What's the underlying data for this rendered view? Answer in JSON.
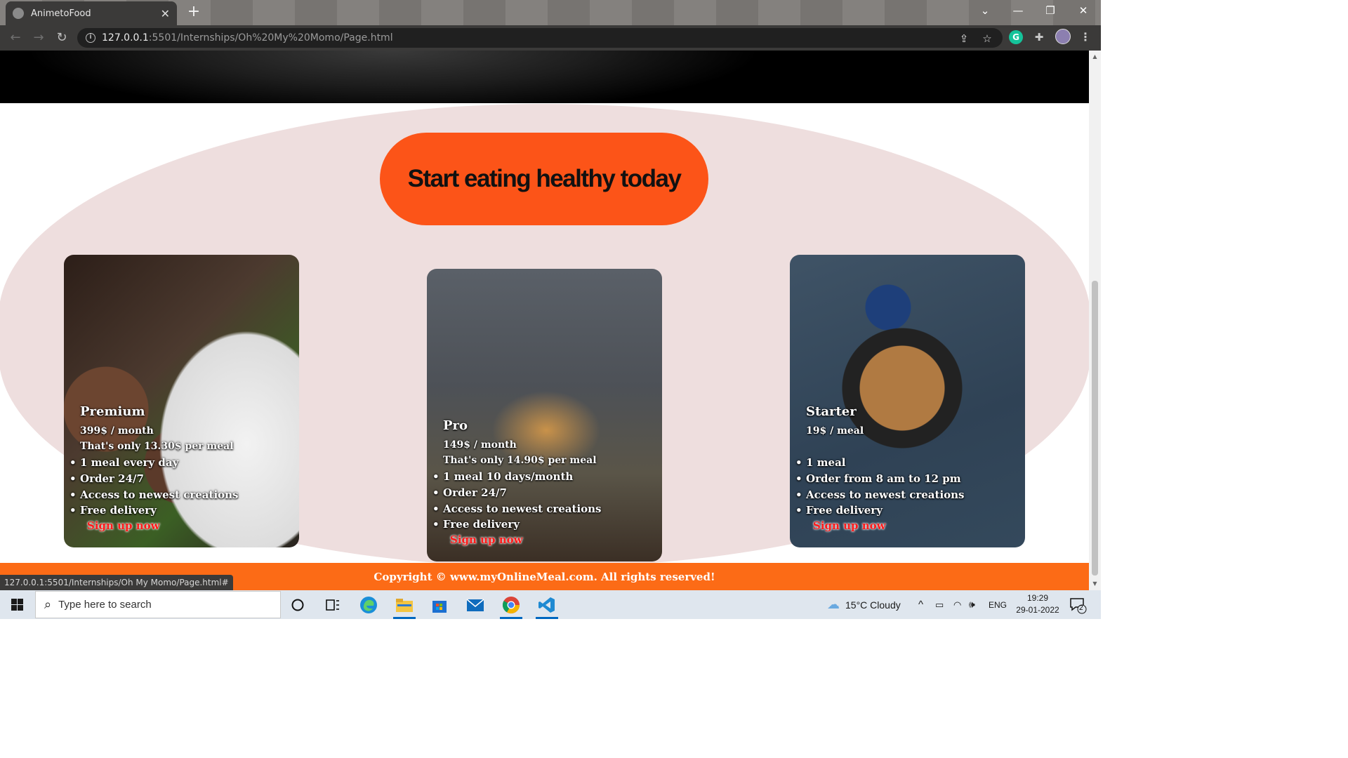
{
  "browser": {
    "tab_title": "AnimetoFood",
    "tab_close": "✕",
    "new_tab": "+",
    "url_host": "127.0.0.1",
    "url_path": ":5501/Internships/Oh%20My%20Momo/Page.html",
    "status_url": "127.0.0.1:5501/Internships/Oh My Momo/Page.html#"
  },
  "page": {
    "cta": "Start eating healthy today",
    "plans": [
      {
        "name": "Premium",
        "price": "399$ / month",
        "per_meal": "That's only 13.30$ per meal",
        "features": [
          "1 meal every day",
          "Order 24/7",
          "Access to newest creations",
          "Free delivery"
        ],
        "signup": "Sign up now"
      },
      {
        "name": "Pro",
        "price": "149$ / month",
        "per_meal": "That's only 14.90$ per meal",
        "features": [
          "1 meal 10 days/month",
          "Order 24/7",
          "Access to newest creations",
          "Free delivery"
        ],
        "signup": "Sign up now"
      },
      {
        "name": "Starter",
        "price": "19$ / meal",
        "per_meal": "",
        "features": [
          "1 meal",
          "Order from 8 am to 12 pm",
          "Access to newest creations",
          "Free delivery"
        ],
        "signup": "Sign up now"
      }
    ],
    "footer": "Copyright © www.myOnlineMeal.com. All rights reserved!"
  },
  "taskbar": {
    "search_placeholder": "Type here to search",
    "weather": "15°C  Cloudy",
    "language": "ENG",
    "time": "19:29",
    "date": "29-01-2022",
    "notification_count": "2"
  },
  "colors": {
    "accent_orange": "#fc5418",
    "footer_orange": "#fc6b16",
    "pink_bg": "#eedede",
    "signup_red": "#ff1a1a"
  }
}
